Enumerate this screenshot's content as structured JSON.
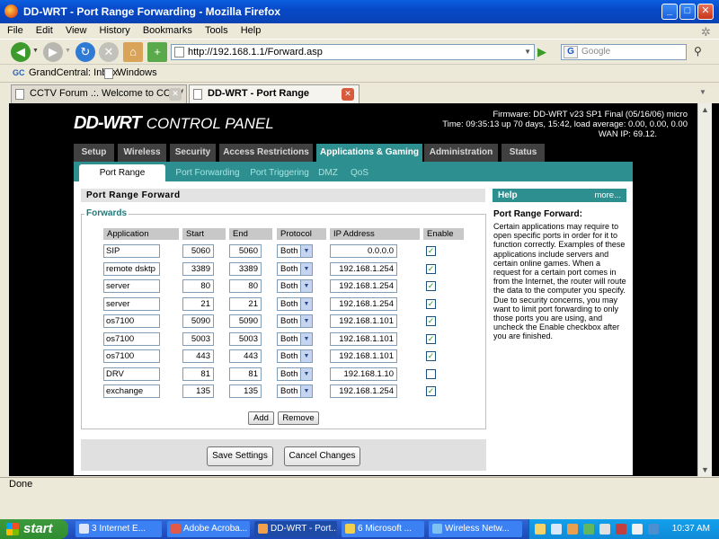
{
  "window": {
    "title": "DD-WRT - Port Range Forwarding - Mozilla Firefox",
    "controls": [
      "_",
      "□",
      "✕"
    ]
  },
  "menu": [
    "File",
    "Edit",
    "View",
    "History",
    "Bookmarks",
    "Tools",
    "Help"
  ],
  "nav": {
    "url": "http://192.168.1.1/Forward.asp",
    "search_placeholder": "Google",
    "search_engine_letter": "G"
  },
  "bookmarks": [
    {
      "label": "GrandCentral: Inbox",
      "icon_text": "GC"
    },
    {
      "label": "Windows"
    }
  ],
  "tabs": [
    {
      "label": "CCTV Forum .:. Welcome to CCTV For...",
      "active": false
    },
    {
      "label": "DD-WRT - Port Range Forwarding",
      "active": true
    }
  ],
  "router": {
    "logo_main": "DD-WRT",
    "logo_sub": "CONTROL PANEL",
    "firmware": "Firmware: DD-WRT v23 SP1 Final (05/16/06) micro",
    "time": "Time: 09:35:13 up 70 days, 15:42, load average: 0.00, 0.00, 0.00",
    "wan_ip": "WAN IP: 69.12.",
    "main_tabs": [
      "Setup",
      "Wireless",
      "Security",
      "Access Restrictions",
      "Applications & Gaming",
      "Administration",
      "Status"
    ],
    "main_active": "Applications & Gaming",
    "sub_tabs": [
      "Port Range Forwarding",
      "Port Forwarding",
      "Port Triggering",
      "DMZ",
      "QoS"
    ],
    "sub_active": "Port Range Forwarding",
    "section_title": "Port Range Forward",
    "fieldset_legend": "Forwards",
    "columns": [
      "Application",
      "Start",
      "End",
      "Protocol",
      "IP Address",
      "Enable"
    ],
    "rows": [
      {
        "app": "SIP",
        "start": "5060",
        "end": "5060",
        "proto": "Both",
        "ip": "0.0.0.0",
        "enabled": true
      },
      {
        "app": "remote dsktp",
        "start": "3389",
        "end": "3389",
        "proto": "Both",
        "ip": "192.168.1.254",
        "enabled": true
      },
      {
        "app": "server",
        "start": "80",
        "end": "80",
        "proto": "Both",
        "ip": "192.168.1.254",
        "enabled": true
      },
      {
        "app": "server",
        "start": "21",
        "end": "21",
        "proto": "Both",
        "ip": "192.168.1.254",
        "enabled": true
      },
      {
        "app": "os7100",
        "start": "5090",
        "end": "5090",
        "proto": "Both",
        "ip": "192.168.1.101",
        "enabled": true
      },
      {
        "app": "os7100",
        "start": "5003",
        "end": "5003",
        "proto": "Both",
        "ip": "192.168.1.101",
        "enabled": true
      },
      {
        "app": "os7100",
        "start": "443",
        "end": "443",
        "proto": "Both",
        "ip": "192.168.1.101",
        "enabled": true
      },
      {
        "app": "DRV",
        "start": "81",
        "end": "81",
        "proto": "Both",
        "ip": "192.168.1.10",
        "enabled": false
      },
      {
        "app": "exchange",
        "start": "135",
        "end": "135",
        "proto": "Both",
        "ip": "192.168.1.254",
        "enabled": true
      }
    ],
    "add_label": "Add",
    "remove_label": "Remove",
    "save_label": "Save Settings",
    "cancel_label": "Cancel Changes",
    "help": {
      "header": "Help",
      "more": "more...",
      "title": "Port Range Forward:",
      "text": "Certain applications may require to open specific ports in order for it to function correctly. Examples of these applications include servers and certain online games. When a request for a certain port comes in from the Internet, the router will route the data to the computer you specify. Due to security concerns, you may want to limit port forwarding to only those ports you are using, and uncheck the Enable checkbox after you are finished."
    }
  },
  "status": "Done",
  "taskbar": {
    "start": "start",
    "items": [
      {
        "label": "3 Internet E..."
      },
      {
        "label": "Adobe Acroba..."
      },
      {
        "label": "DD-WRT - Port...",
        "active": true
      },
      {
        "label": "6 Microsoft ..."
      },
      {
        "label": "Wireless Netw..."
      }
    ],
    "clock": "10:37 AM"
  },
  "colors": {
    "titlebar": "#0a5fe0",
    "router_accent": "#2d8f8f",
    "tab_dark": "#404040",
    "check": "#21a121"
  }
}
